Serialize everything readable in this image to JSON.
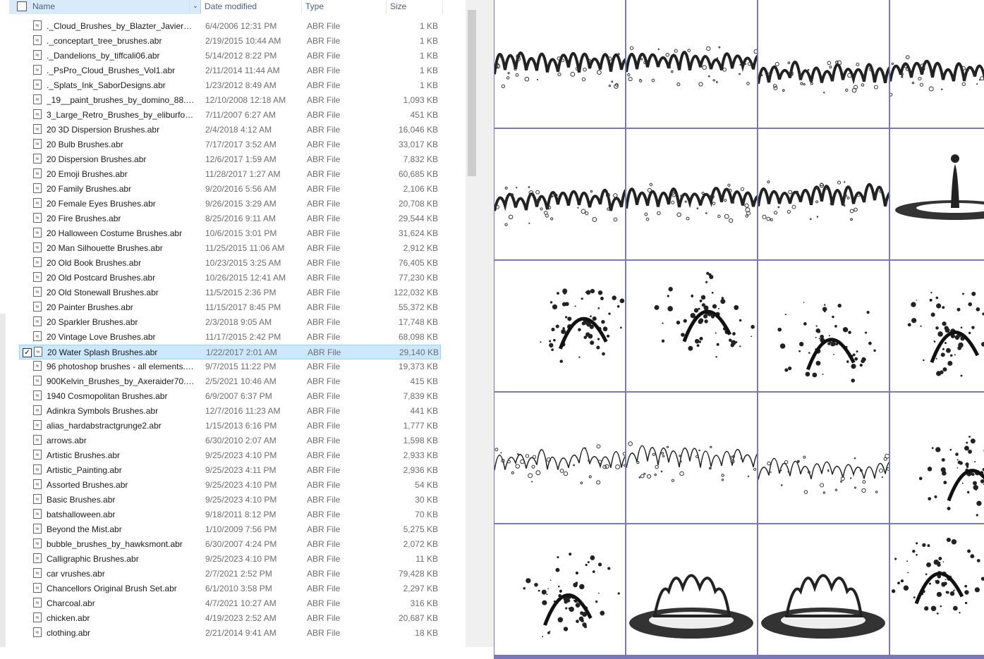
{
  "header": {
    "name": "Name",
    "date_modified": "Date modified",
    "type": "Type",
    "size": "Size"
  },
  "files": [
    {
      "name": "._Cloud_Brushes_by_Blazter_JavierZhX....",
      "date": "6/4/2006 12:31 PM",
      "type": "ABR File",
      "size": "1 KB"
    },
    {
      "name": "._conceptart_tree_brushes.abr",
      "date": "2/19/2015 10:44 AM",
      "type": "ABR File",
      "size": "1 KB"
    },
    {
      "name": "._Dandelions_by_tiffcali06.abr",
      "date": "5/14/2012 8:22 PM",
      "type": "ABR File",
      "size": "1 KB"
    },
    {
      "name": "._PsPro_Cloud_Brushes_Vol1.abr",
      "date": "2/11/2014 11:44 AM",
      "type": "ABR File",
      "size": "1 KB"
    },
    {
      "name": "._Splats_Ink_SaborDesigns.abr",
      "date": "1/23/2012 8:49 AM",
      "type": "ABR File",
      "size": "1 KB"
    },
    {
      "name": "_19__paint_brushes_by_domino_88.abr",
      "date": "12/10/2008 12:18 AM",
      "type": "ABR File",
      "size": "1,093 KB"
    },
    {
      "name": "3_Large_Retro_Brushes_by_eliburford-...",
      "date": "7/11/2007 6:27 AM",
      "type": "ABR File",
      "size": "451 KB"
    },
    {
      "name": "20 3D Dispersion Brushes.abr",
      "date": "2/4/2018 4:12 AM",
      "type": "ABR File",
      "size": "16,046 KB"
    },
    {
      "name": "20 Bulb Brushes.abr",
      "date": "7/17/2017 3:52 AM",
      "type": "ABR File",
      "size": "33,017 KB"
    },
    {
      "name": "20 Dispersion Brushes.abr",
      "date": "12/6/2017 1:59 AM",
      "type": "ABR File",
      "size": "7,832 KB"
    },
    {
      "name": "20 Emoji Brushes.abr",
      "date": "11/28/2017 1:27 AM",
      "type": "ABR File",
      "size": "60,685 KB"
    },
    {
      "name": "20 Family Brushes.abr",
      "date": "9/20/2016 5:56 AM",
      "type": "ABR File",
      "size": "2,106 KB"
    },
    {
      "name": "20 Female Eyes Brushes.abr",
      "date": "9/26/2015 3:29 AM",
      "type": "ABR File",
      "size": "20,708 KB"
    },
    {
      "name": "20 Fire Brushes.abr",
      "date": "8/25/2016 9:11 AM",
      "type": "ABR File",
      "size": "29,544 KB"
    },
    {
      "name": "20 Halloween Costume Brushes.abr",
      "date": "10/6/2015 3:01 PM",
      "type": "ABR File",
      "size": "31,624 KB"
    },
    {
      "name": "20 Man Silhouette Brushes.abr",
      "date": "11/25/2015 11:06 AM",
      "type": "ABR File",
      "size": "2,912 KB"
    },
    {
      "name": "20 Old Book Brushes.abr",
      "date": "10/23/2015 3:25 AM",
      "type": "ABR File",
      "size": "76,405 KB"
    },
    {
      "name": "20 Old Postcard Brushes.abr",
      "date": "10/26/2015 12:41 AM",
      "type": "ABR File",
      "size": "77,230 KB"
    },
    {
      "name": "20 Old Stonewall  Brushes.abr",
      "date": "11/5/2015 2:36 PM",
      "type": "ABR File",
      "size": "122,032 KB"
    },
    {
      "name": "20 Painter Brushes.abr",
      "date": "11/15/2017 8:45 PM",
      "type": "ABR File",
      "size": "55,372 KB"
    },
    {
      "name": "20 Sparkler Brushes.abr",
      "date": "2/3/2018 9:05 AM",
      "type": "ABR File",
      "size": "17,748 KB"
    },
    {
      "name": "20 Vintage Love  Brushes.abr",
      "date": "11/17/2015 2:42 PM",
      "type": "ABR File",
      "size": "68,098 KB"
    },
    {
      "name": "20 Water Splash Brushes.abr",
      "date": "1/22/2017 2:01 AM",
      "type": "ABR File",
      "size": "29,140 KB",
      "selected": true
    },
    {
      "name": "96 photoshop brushes - all elements.abr",
      "date": "9/7/2015 11:22 PM",
      "type": "ABR File",
      "size": "19,373 KB"
    },
    {
      "name": "900Kelvin_Brushes_by_Axeraider70.abr",
      "date": "2/5/2021 10:46 AM",
      "type": "ABR File",
      "size": "415 KB"
    },
    {
      "name": "1940 Cosmopolitan Brushes.abr",
      "date": "6/9/2007 6:37 PM",
      "type": "ABR File",
      "size": "7,839 KB"
    },
    {
      "name": "Adinkra Symbols Brushes.abr",
      "date": "12/7/2016 11:23 AM",
      "type": "ABR File",
      "size": "441 KB"
    },
    {
      "name": "alias_hardabstractgrunge2.abr",
      "date": "1/15/2013 6:16 PM",
      "type": "ABR File",
      "size": "1,777 KB"
    },
    {
      "name": "arrows.abr",
      "date": "6/30/2010 2:07 AM",
      "type": "ABR File",
      "size": "1,598 KB"
    },
    {
      "name": "Artistic Brushes.abr",
      "date": "9/25/2023 4:10 PM",
      "type": "ABR File",
      "size": "2,933 KB"
    },
    {
      "name": "Artistic_Painting.abr",
      "date": "9/25/2023 4:11 PM",
      "type": "ABR File",
      "size": "2,936 KB"
    },
    {
      "name": "Assorted Brushes.abr",
      "date": "9/25/2023 4:10 PM",
      "type": "ABR File",
      "size": "54 KB"
    },
    {
      "name": "Basic Brushes.abr",
      "date": "9/25/2023 4:10 PM",
      "type": "ABR File",
      "size": "30 KB"
    },
    {
      "name": "batshalloween.abr",
      "date": "9/18/2011 8:12 PM",
      "type": "ABR File",
      "size": "70 KB"
    },
    {
      "name": "Beyond the Mist.abr",
      "date": "1/10/2009 7:56 PM",
      "type": "ABR File",
      "size": "5,275 KB"
    },
    {
      "name": "bubble_brushes_by_hawksmont.abr",
      "date": "6/30/2007 4:24 PM",
      "type": "ABR File",
      "size": "2,072 KB"
    },
    {
      "name": "Calligraphic Brushes.abr",
      "date": "9/25/2023 4:10 PM",
      "type": "ABR File",
      "size": "11 KB"
    },
    {
      "name": "car vrushes.abr",
      "date": "2/7/2021 2:52 PM",
      "type": "ABR File",
      "size": "79,428 KB"
    },
    {
      "name": "Chancellors Original Brush Set.abr",
      "date": "6/1/2010 3:58 PM",
      "type": "ABR File",
      "size": "2,297 KB"
    },
    {
      "name": "Charcoal.abr",
      "date": "4/7/2021 10:27 AM",
      "type": "ABR File",
      "size": "316 KB"
    },
    {
      "name": "chicken.abr",
      "date": "4/19/2023 2:52 AM",
      "type": "ABR File",
      "size": "20,687 KB"
    },
    {
      "name": "clothing.abr",
      "date": "2/21/2014 9:41 AM",
      "type": "ABR File",
      "size": "18 KB"
    }
  ],
  "preview": {
    "colors": {
      "grid": "#7a78b8",
      "selection": "#cce8ff",
      "header_name": "#d9ebf9"
    },
    "thumbnails": [
      "water-splash-wave",
      "water-splash-wave",
      "water-splash-wave",
      "water-splash-wave",
      "water-splash-wave",
      "water-splash-wave",
      "water-splash-wave",
      "water-drop",
      "water-splash-burst",
      "water-splash-burst",
      "water-splash-burst",
      "water-splash-burst",
      "water-splash-streak",
      "water-splash-streak",
      "water-splash-streak",
      "water-splash-burst",
      "water-splash-burst",
      "water-splash-crown",
      "water-splash-crown",
      "water-splash-burst"
    ]
  }
}
